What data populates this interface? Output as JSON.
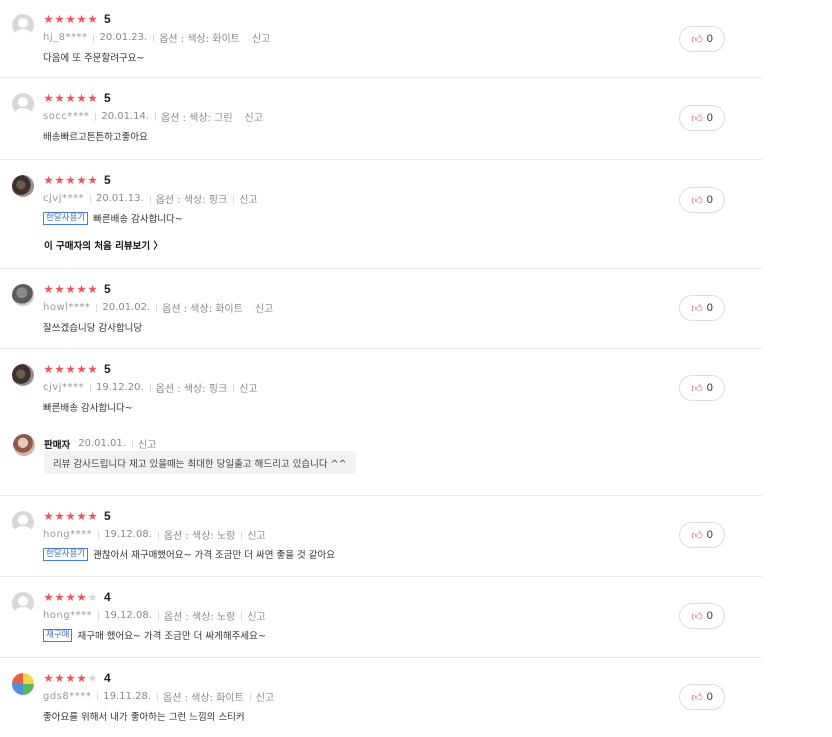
{
  "like_icon": "thumbs-up-icon",
  "star_color": "#f0555b",
  "tag_color": "#3e6cc9",
  "reviews": [
    {
      "user": "hj_8****",
      "date": "20.01.23.",
      "option": "옵션 : 색상: 화이트",
      "report": "신고",
      "score": "5",
      "stars": 5,
      "tag": "",
      "text": "다음에 또 주문할려구요~",
      "likes": "0"
    },
    {
      "user": "socc****",
      "date": "20.01.14.",
      "option": "옵션 : 색상: 그린",
      "report": "신고",
      "score": "5",
      "stars": 5,
      "tag": "",
      "text": "배송빠르고튼튼하고좋아요",
      "likes": "0"
    },
    {
      "user": "cjvj****",
      "date": "20.01.13.",
      "option": "옵션 : 색상: 핑크",
      "report": "신고",
      "score": "5",
      "stars": 5,
      "tag": "한달사용기",
      "text": "빠른배송 감사합니다~",
      "first_review_link": "이 구매자의 처음 리뷰보기 〉",
      "likes": "0"
    },
    {
      "user": "howl****",
      "date": "20.01.02.",
      "option": "옵션 : 색상: 화이트",
      "report": "신고",
      "score": "5",
      "stars": 5,
      "tag": "",
      "text": "잘쓰겠습니당 감사합니당",
      "likes": "0"
    },
    {
      "user": "cjvj****",
      "date": "19.12.20.",
      "option": "옵션 : 색상: 핑크",
      "report": "신고",
      "score": "5",
      "stars": 5,
      "tag": "",
      "text": "빠른배송 감사합니다~",
      "likes": "0",
      "seller_reply": {
        "name": "판매자",
        "date": "20.01.01.",
        "report": "신고",
        "text": "리뷰 감사드립니다 재고 있을때는 최대한 당일출고 해드리고 있습니다 ^^"
      }
    },
    {
      "user": "hong****",
      "date": "19.12.08.",
      "option": "옵션 : 색상: 노랑",
      "report": "신고",
      "score": "5",
      "stars": 5,
      "tag": "한달사용기",
      "text": "괜찮아서 재구매했어요~ 가격 조금만 더 싸면 좋을 것 같아요",
      "likes": "0"
    },
    {
      "user": "hong****",
      "date": "19.12.08.",
      "option": "옵션 : 색상: 노랑",
      "report": "신고",
      "score": "4",
      "stars": 4,
      "tag": "재구매",
      "text": "재구매 했어요~ 가격 조금만 더 싸게해주세요~",
      "likes": "0"
    },
    {
      "user": "gds8****",
      "date": "19.11.28.",
      "option": "옵션 : 색상: 화이트",
      "report": "신고",
      "score": "4",
      "stars": 4,
      "tag": "",
      "text": "좋아요를 위해서 내가 좋아하는 그런 느낌의 스티커",
      "likes": "0"
    }
  ]
}
